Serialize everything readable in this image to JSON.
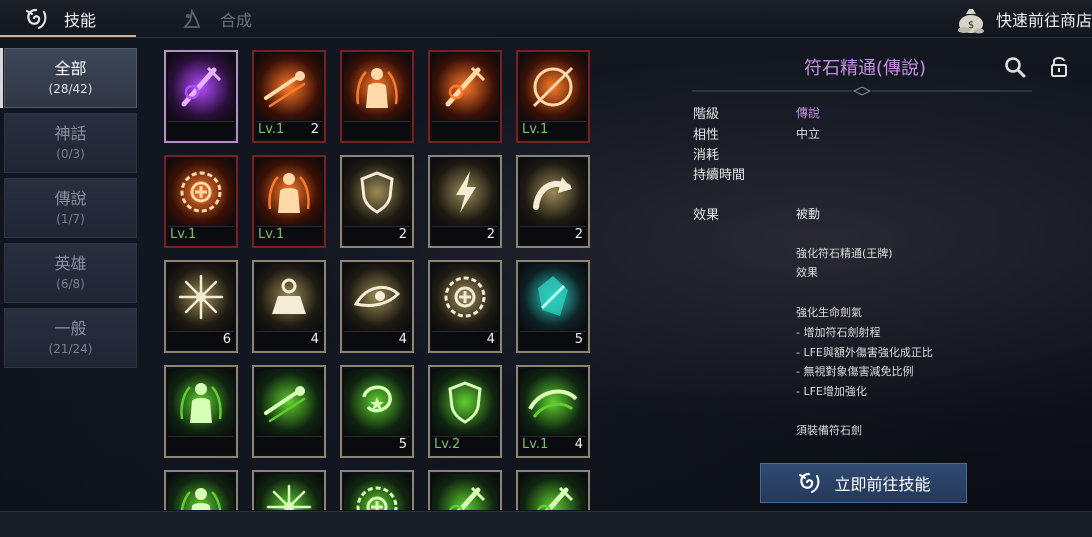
{
  "top_bar": {
    "tabs": [
      {
        "label": "技能",
        "icon": "skill-swirl-icon",
        "active": true
      },
      {
        "label": "合成",
        "icon": "craft-icon",
        "active": false
      }
    ],
    "shortcut_label": "快速前往商店",
    "shortcut_icon": "money-bag-icon"
  },
  "categories": [
    {
      "name": "全部",
      "count": "(28/42)",
      "active": true
    },
    {
      "name": "神話",
      "count": "(0/3)",
      "active": false
    },
    {
      "name": "傳說",
      "count": "(1/7)",
      "active": false
    },
    {
      "name": "英雄",
      "count": "(6/8)",
      "active": false
    },
    {
      "name": "一般",
      "count": "(21/24)",
      "active": false
    }
  ],
  "grid": {
    "rows": [
      [
        {
          "icon": "purple-sword-rune-icon",
          "frame": "selected",
          "level": "",
          "count": ""
        },
        {
          "icon": "dash-slash-icon",
          "frame": "red",
          "level": "Lv.1",
          "count": "2"
        },
        {
          "icon": "body-aura-icon",
          "frame": "red",
          "level": "",
          "count": ""
        },
        {
          "icon": "flame-blade-icon",
          "frame": "red",
          "level": "",
          "count": ""
        },
        {
          "icon": "fire-orb-sword-icon",
          "frame": "red",
          "level": "Lv.1",
          "count": ""
        }
      ],
      [
        {
          "icon": "healing-rune-circle-icon",
          "frame": "red",
          "level": "Lv.1",
          "count": ""
        },
        {
          "icon": "body-flames-icon",
          "frame": "red",
          "level": "Lv.1",
          "count": ""
        },
        {
          "icon": "shield-icon",
          "frame": "gold",
          "level": "",
          "count": "2"
        },
        {
          "icon": "lightning-icon",
          "frame": "gold",
          "level": "",
          "count": "2"
        },
        {
          "icon": "curved-arrow-icon",
          "frame": "gold",
          "level": "",
          "count": "2"
        }
      ],
      [
        {
          "icon": "starburst-icon",
          "frame": "gold",
          "level": "",
          "count": "6"
        },
        {
          "icon": "weight-marker-icon",
          "frame": "gold",
          "level": "",
          "count": "4"
        },
        {
          "icon": "eye-icon",
          "frame": "gold",
          "level": "",
          "count": "4"
        },
        {
          "icon": "thorn-ring-icon",
          "frame": "gold",
          "level": "",
          "count": "4"
        },
        {
          "icon": "cyan-crystal-icon",
          "frame": "gold",
          "level": "",
          "count": "5"
        }
      ],
      [
        {
          "icon": "green-body-aura-icon",
          "frame": "gold",
          "level": "",
          "count": ""
        },
        {
          "icon": "green-dash-icon",
          "frame": "gold",
          "level": "",
          "count": ""
        },
        {
          "icon": "green-star-swirl-icon",
          "frame": "gold",
          "level": "",
          "count": "5"
        },
        {
          "icon": "green-shield-swirl-icon",
          "frame": "gold",
          "level": "Lv.2",
          "count": ""
        },
        {
          "icon": "green-wind-blade-icon",
          "frame": "gold",
          "level": "Lv.1",
          "count": "4"
        }
      ],
      [
        {
          "icon": "green-crowd-icon",
          "frame": "gold",
          "level": "",
          "count": ""
        },
        {
          "icon": "green-burst-icon",
          "frame": "gold",
          "level": "",
          "count": ""
        },
        {
          "icon": "green-rune-circle-icon",
          "frame": "gold",
          "level": "",
          "count": ""
        },
        {
          "icon": "green-sword-rune-icon",
          "frame": "gold",
          "level": "",
          "count": ""
        },
        {
          "icon": "green-blade-icon",
          "frame": "gold",
          "level": "",
          "count": ""
        }
      ]
    ]
  },
  "detail": {
    "title": "符石精通(傳說)",
    "fields": [
      {
        "label": "階級",
        "value": "傳說"
      },
      {
        "label": "相性",
        "value": "中立"
      },
      {
        "label": "消耗",
        "value": ""
      },
      {
        "label": "持續時間",
        "value": ""
      },
      {
        "label": "效果",
        "value": "被動"
      }
    ],
    "description": [
      "強化符石精通(王牌)",
      "效果",
      "",
      "強化生命劍氣",
      "- 增加符石劍射程",
      "- LFE與額外傷害強化成正比",
      "- 無視對象傷害減免比例",
      "- LFE增加強化",
      "",
      "須裝備符石劍"
    ],
    "go_button_label": "立即前往技能"
  },
  "colors": {
    "legendary_purple": "#c58ee0",
    "level_green": "#7fbf6a",
    "gold_frame": "#8a8470",
    "red_frame": "#7a1e1e"
  }
}
